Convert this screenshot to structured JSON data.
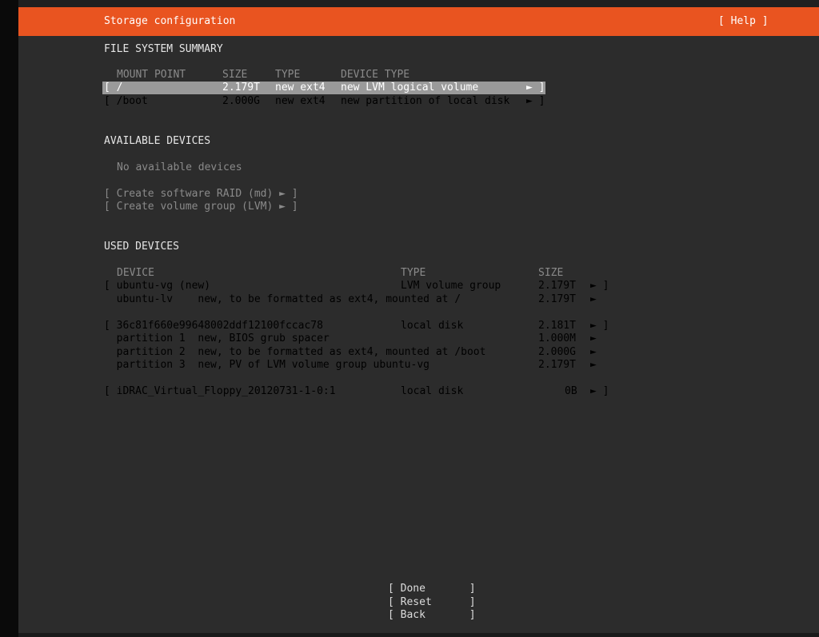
{
  "header": {
    "title": "Storage configuration",
    "help": "[ Help ]"
  },
  "fs_summary": {
    "heading": "FILE SYSTEM SUMMARY",
    "columns": {
      "mount": "MOUNT POINT",
      "size": "SIZE",
      "type": "TYPE",
      "device_type": "DEVICE TYPE"
    },
    "rows": [
      {
        "mount": "[ /",
        "size": "2.179T",
        "type": "new ext4",
        "device_type": "new LVM logical volume",
        "arrow": "► ]"
      },
      {
        "mount": "[ /boot",
        "size": "2.000G",
        "type": "new ext4",
        "device_type": "new partition of local disk",
        "arrow": "► ]"
      }
    ]
  },
  "available": {
    "heading": "AVAILABLE DEVICES",
    "empty": "No available devices",
    "actions": [
      "[ Create software RAID (md) ► ]",
      "[ Create volume group (LVM) ► ]"
    ]
  },
  "used": {
    "heading": "USED DEVICES",
    "columns": {
      "device": "DEVICE",
      "type": "TYPE",
      "size": "SIZE"
    },
    "rows": [
      {
        "device": "[ ubuntu-vg (new)",
        "type": "LVM volume group",
        "size": "2.179T",
        "arrow": "► ]"
      },
      {
        "device": "  ubuntu-lv    new, to be formatted as ext4, mounted at /",
        "type": "",
        "size": "2.179T",
        "arrow": "►"
      },
      {
        "device": "[ 36c81f660e99648002ddf12100fccac78",
        "type": "local disk",
        "size": "2.181T",
        "arrow": "► ]"
      },
      {
        "device": "  partition 1  new, BIOS grub spacer",
        "type": "",
        "size": "1.000M",
        "arrow": "►"
      },
      {
        "device": "  partition 2  new, to be formatted as ext4, mounted at /boot",
        "type": "",
        "size": "2.000G",
        "arrow": "►"
      },
      {
        "device": "  partition 3  new, PV of LVM volume group ubuntu-vg",
        "type": "",
        "size": "2.179T",
        "arrow": "►"
      },
      {
        "device": "[ iDRAC_Virtual_Floppy_20120731-1-0:1",
        "type": "local disk",
        "size": "0B",
        "arrow": "► ]"
      }
    ]
  },
  "buttons": {
    "done": "[ Done       ]",
    "reset": "[ Reset      ]",
    "back": "[ Back       ]"
  }
}
